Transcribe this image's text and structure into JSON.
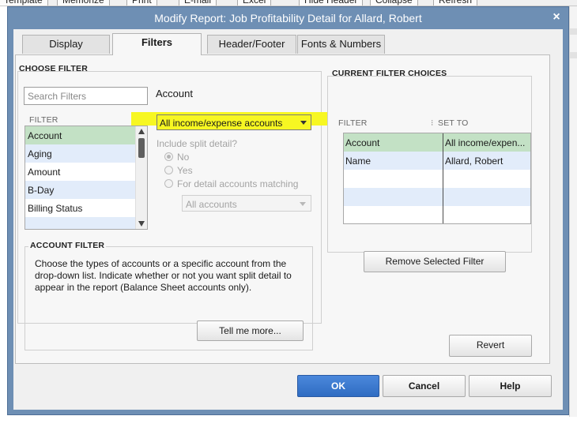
{
  "background_toolbar": {
    "buttons": [
      "Template",
      "Memorize",
      "Print",
      "E-mail",
      "Excel",
      "Hide Header",
      "Collapse",
      "Refresh"
    ]
  },
  "dialog": {
    "title": "Modify Report: Job Profitability Detail for Allard, Robert",
    "close_glyph": "×"
  },
  "tabs": [
    {
      "label": "Display",
      "key": "D"
    },
    {
      "label": "Filters",
      "key": "F"
    },
    {
      "label": "Header/Footer",
      "key": "H"
    },
    {
      "label": "Fonts & Numbers",
      "key": "n"
    }
  ],
  "choose_filter": {
    "heading": "CHOOSE FILTER",
    "search_placeholder": "Search Filters",
    "filter_column": "FILTER",
    "items": [
      "Account",
      "Aging",
      "Amount",
      "B-Day",
      "Billing Status"
    ]
  },
  "account": {
    "label": "Account",
    "selected": "All income/expense accounts",
    "split_detail_label": "Include split detail?",
    "radio_no": "No",
    "radio_yes": "Yes",
    "radio_matching": "For detail accounts matching",
    "matching_value": "All accounts"
  },
  "account_filter": {
    "heading": "ACCOUNT FILTER",
    "description": "Choose the types of accounts or a specific account from the drop-down list. Indicate whether or not you want split detail to appear in the report (Balance Sheet accounts only).",
    "tell_me_more": "Tell me more..."
  },
  "current_filter_choices": {
    "heading": "CURRENT FILTER CHOICES",
    "col_filter": "FILTER",
    "col_set_to": "SET TO",
    "rows": [
      {
        "filter": "Account",
        "set_to": "All income/expen..."
      },
      {
        "filter": "Name",
        "set_to": "Allard, Robert"
      }
    ],
    "remove_button": "Remove Selected Filter"
  },
  "buttons": {
    "revert": "Revert",
    "ok": "OK",
    "cancel": "Cancel",
    "help": "Help"
  },
  "colors": {
    "highlight": "#f7f722",
    "selected_row": "#c3e1c5",
    "alt_row": "#e2ecfa",
    "title_bar": "#6e8fb4",
    "ok_button": "#3a78cf"
  }
}
